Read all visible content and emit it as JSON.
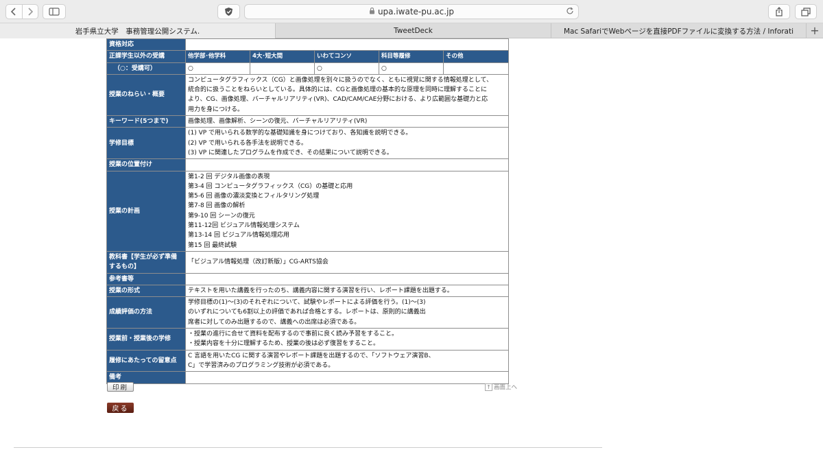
{
  "browser": {
    "url": "upa.iwate-pu.ac.jp",
    "tabs": [
      {
        "label": "岩手県立大学　事務管理公開システム."
      },
      {
        "label": "TweetDeck"
      },
      {
        "label": "Mac SafariでWebページを直接PDFファイルに変換する方法 / Inforati"
      }
    ]
  },
  "syllabus": {
    "row_shikaku": {
      "header": "資格対応",
      "value": ""
    },
    "row_other": {
      "header": "正課学生以外の受講",
      "cols": [
        "他学部･他学科",
        "4大･短大間",
        "いわてコンソ",
        "科目等履修",
        "その他"
      ],
      "sub_header": "（○：受講可）",
      "marks": [
        "○",
        "",
        "○",
        "○",
        ""
      ]
    },
    "row_aim": {
      "header": "授業のねらい・概要",
      "lines": [
        "コンピュータグラフィックス（CG）と画像処理を別々に扱うのでなく、ともに視覚に関する情報処理として、",
        "統合的に扱うことをねらいとしている。具体的には、CGと画像処理の基本的な原理を同時に理解することに",
        "より、CG、画像処理、バーチャルリアリティ(VR)、CAD/CAM/CAE分野における、より広範囲な基礎力と応",
        "用力を身につける。"
      ]
    },
    "row_keyword": {
      "header": "キーワード(5つまで)",
      "value": "画像処理、画像解析、シーンの復元、バーチャルリアリティ(VR)"
    },
    "row_goal": {
      "header": "学修目標",
      "lines": [
        "(1) VP で用いられる数学的な基礎知識を身につけており、各知識を説明できる。",
        "(2) VP で用いられる各手法を説明できる。",
        "(3) VP に関連したプログラムを作成でき、その結果について説明できる。"
      ]
    },
    "row_position": {
      "header": "授業の位置付け",
      "value": ""
    },
    "row_plan": {
      "header": "授業の計画",
      "lines": [
        "第1-2 回 デジタル画像の表現",
        "第3-4 回 コンピュータグラフィックス（CG）の基礎と応用",
        "第5-6 回 画像の濃淡変換とフィルタリング処理",
        "第7-8 回 画像の解析",
        "第9-10 回 シーンの復元",
        "第11-12回 ビジュアル情報処理システム",
        "第13-14 回 ビジュアル情報処理応用",
        "第15 回 最終試験"
      ]
    },
    "row_textbook": {
      "header_lines": [
        "教科書【学生が必ず準備",
        "するもの】"
      ],
      "value": "「ビジュアル情報処理（改訂新版）」CG-ARTS協会"
    },
    "row_reference": {
      "header": "参考書等",
      "value": ""
    },
    "row_format": {
      "header": "授業の形式",
      "value": "テキストを用いた講義を行ったのち、講義内容に関する演習を行い、レポート課題を出題する。"
    },
    "row_eval": {
      "header": "成績評価の方法",
      "lines": [
        "学修目標の(1)～(3)のそれぞれについて、試験やレポートによる評価を行う。(1)～(3)",
        "のいずれについても6割以上の評価であれば合格とする。レポートは、原則的に講義出",
        "席者に対してのみ出題するので、講義への出席は必須である。"
      ]
    },
    "row_study": {
      "header": "授業前・授業後の学修",
      "lines": [
        "・授業の進行に合せて資料を配布するので事前に良く読み予習をすること。",
        "・授業内容を十分に理解するため、授業の後は必ず復習をすること。"
      ]
    },
    "row_notes": {
      "header": "履修にあたっての留意点",
      "lines": [
        "C 言語を用いたCG に関する演習やレポート課題を出題するので、「ソフトウェア演習B、",
        "C」で学習済みのプログラミング技術が必須である。"
      ]
    },
    "row_remarks": {
      "header": "備考",
      "value": ""
    }
  },
  "buttons": {
    "print": "印刷",
    "back": "戻る",
    "to_top": "画面上へ"
  }
}
